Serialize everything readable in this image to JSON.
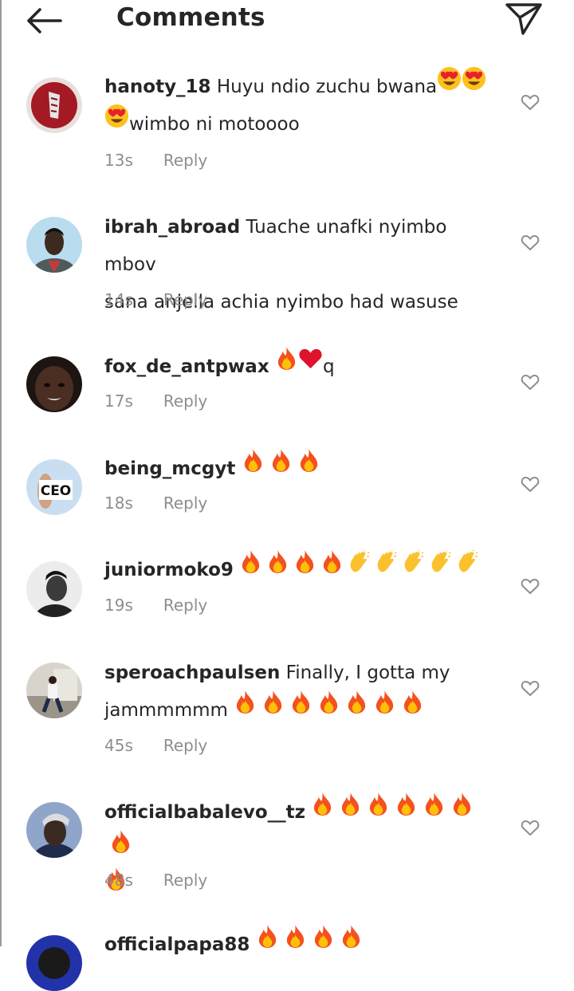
{
  "header": {
    "title": "Comments"
  },
  "reply_label": "Reply",
  "comments": [
    {
      "username": "hanoty_18",
      "line1": "Huyu ndio zuchu bwana",
      "line2": "wimbo ni motoooo",
      "time": "13s"
    },
    {
      "username": "ibrah_abroad",
      "line1": "Tuache unafki nyimbo mbov",
      "line2": "sana anjella achia nyimbo had wasuse",
      "time": "14s"
    },
    {
      "username": "fox_de_antpwax",
      "text": "q",
      "time": "17s"
    },
    {
      "username": "being_mcgyt",
      "time": "18s",
      "avatar_text": "CEO"
    },
    {
      "username": "juniormoko9",
      "time": "19s"
    },
    {
      "username": "speroachpaulsen",
      "line1": "Finally, I gotta my",
      "line2": "jammmmmm",
      "time": "45s"
    },
    {
      "username": "officialbabalevo__tz",
      "time": "48s"
    },
    {
      "username": "officialpapa88"
    }
  ]
}
